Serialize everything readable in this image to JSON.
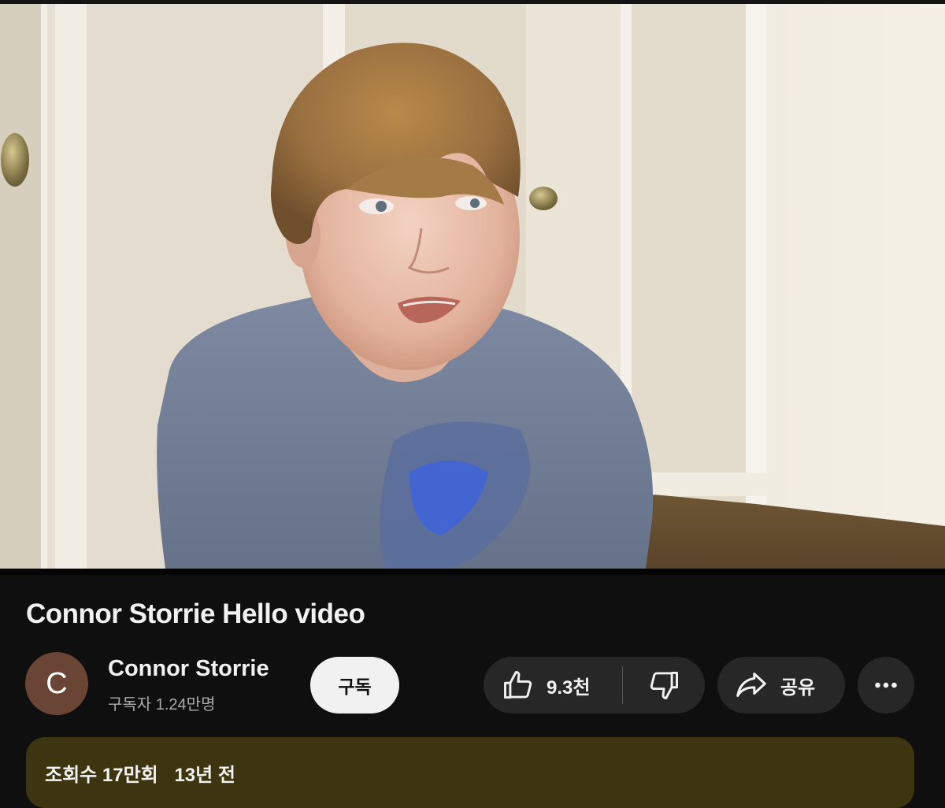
{
  "video": {
    "description": "video frame"
  },
  "title": "Connor Storrie Hello video",
  "channel": {
    "avatar_letter": "C",
    "name": "Connor Storrie",
    "subscribers": "구독자 1.24만명",
    "subscribe_label": "구독"
  },
  "actions": {
    "like_count": "9.3천",
    "share_label": "공유",
    "like_icon": "thumbs-up-icon",
    "dislike_icon": "thumbs-down-icon",
    "share_icon": "share-arrow-icon",
    "more_icon": "more-horizontal-icon"
  },
  "description_box": {
    "views": "조회수 17만회",
    "age": "13년 전"
  },
  "colors": {
    "background": "#0f0f0f",
    "pill": "#272727",
    "subscribe_bg": "#f1f1f1",
    "avatar": "#6a4435",
    "description_bg": "#3c3510"
  }
}
